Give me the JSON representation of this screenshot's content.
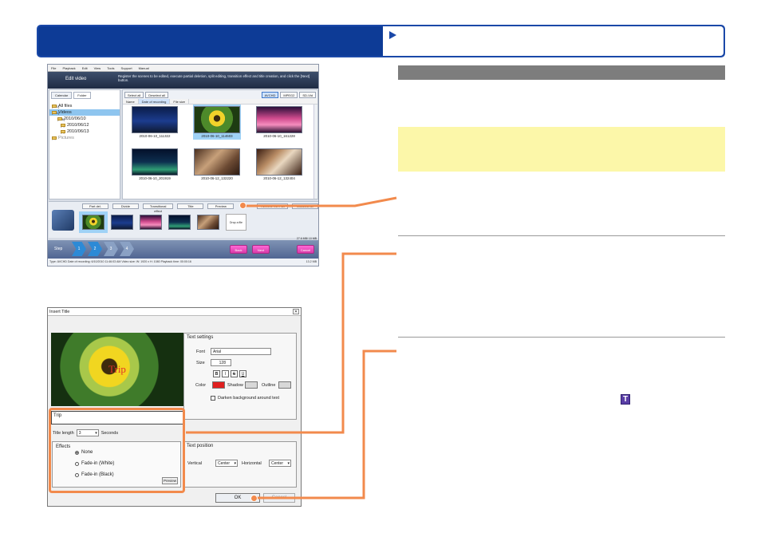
{
  "colors": {
    "banner": "#0d3b96",
    "callout": "#f28a4c",
    "note": "#fcf7a9",
    "header_gray": "#7d7d7d"
  },
  "edit_video": {
    "menu": [
      "File",
      "Playback",
      "Edit",
      "View",
      "Tools",
      "Support",
      "Manual"
    ],
    "title": "Edit video",
    "instruction": "Register the scenes to be edited, execute partial deletion, split editing, transition effect and title creation, and click the [Next] button.",
    "tabs": [
      "Calendar",
      "Folder"
    ],
    "tree": [
      {
        "label": "All files",
        "count": "(231)"
      },
      {
        "label": "Videos",
        "count": "(231)"
      },
      {
        "label": "2010/06/10",
        "count": "(106)"
      },
      {
        "label": "2010/06/12",
        "count": "(6)"
      },
      {
        "label": "2010/06/13",
        "count": "(0)"
      },
      {
        "label": "Pictures",
        "count": "(0)"
      }
    ],
    "filtering": "Filtering pictures",
    "toolbar": {
      "select_all": "Select all",
      "deselect_all": "Deselect all",
      "avchd": "AVCHD",
      "mpeg2": "MPEG2",
      "sdvid": "SD-Vid"
    },
    "columns": [
      "Name",
      "Date of recording",
      "File size"
    ],
    "thumbs": [
      "2010-06-10_111322",
      "2010-06-10_114603",
      "2010-06-10_161228",
      "2010-06-10_201919",
      "2010-06-12_132220",
      "2010-06-12_132404"
    ],
    "strip_buttons": [
      "Part del.",
      "Divide",
      "Transitional effect",
      "Title",
      "Preview",
      "Remove from list",
      "Deselect all"
    ],
    "drop_label": "Drop a file",
    "strip_size": "27.6 MB/ 10 MB",
    "step": {
      "label": "Step",
      "n1": "1",
      "n2": "2",
      "n3": "3",
      "n4": "4",
      "back": "Back",
      "next": "Next",
      "cancel": "Cancel"
    },
    "status": "Type: AVCHD  Date of recording: 6/10/2010 11:46:03 AM  Video size: W: 1920 x H: 1080  Playback time: 00:00:16",
    "status_size": "13.2 MB"
  },
  "insert_title": {
    "window_title": "Insert Title",
    "close": "✕",
    "overlay_text": "Trip",
    "input_value": "Trip",
    "title_length_label": "Title length",
    "title_length_value": "3",
    "seconds": "Seconds",
    "effects": {
      "heading": "Effects",
      "none": "None",
      "fade_white": "Fade-in (White)",
      "fade_black": "Fade-in (Black)",
      "preview": "Preview"
    },
    "text_settings": {
      "heading": "Text settings",
      "font_label": "Font",
      "font_value": "Arial",
      "size_label": "Size",
      "size_value": "128",
      "bold": "B",
      "italic": "I",
      "strike": "S",
      "underline": "U",
      "color_label": "Color",
      "shadow_label": "Shadow",
      "outline_label": "Outline",
      "darken": "Darken background around text"
    },
    "text_position": {
      "heading": "Text position",
      "vertical_label": "Vertical",
      "vertical_value": "Center",
      "horizontal_label": "Horizontal",
      "horizontal_value": "Center"
    },
    "ok": "OK",
    "cancel": "Cancel"
  },
  "title_icon": "T"
}
